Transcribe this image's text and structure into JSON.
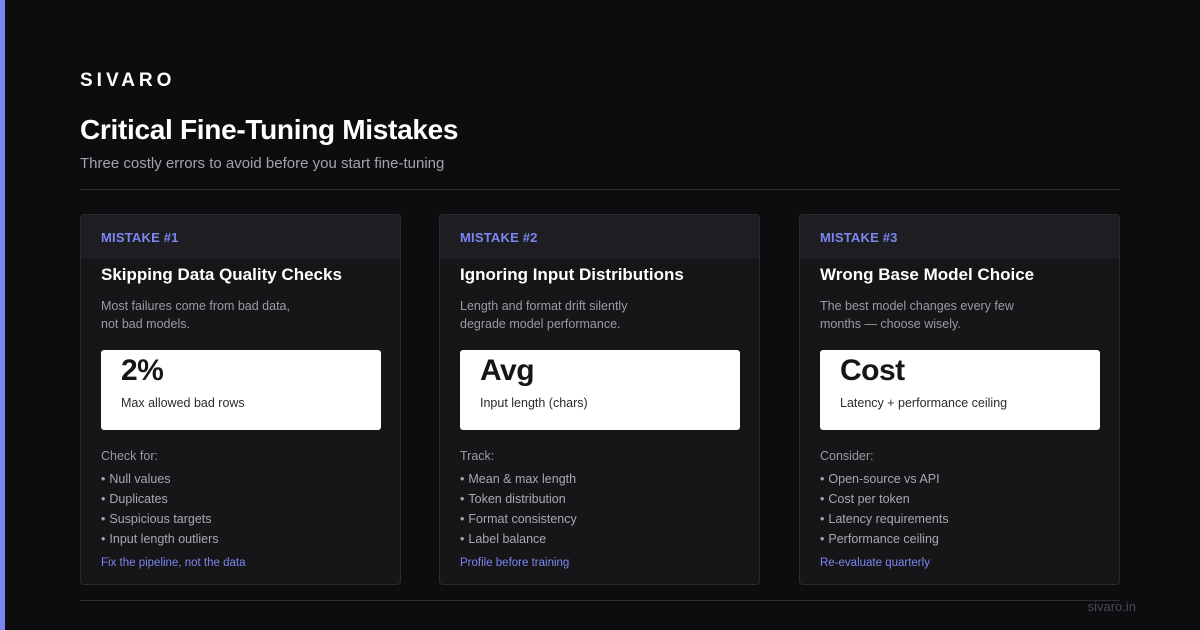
{
  "brand": "SIVARO",
  "title": "Critical Fine-Tuning Mistakes",
  "subtitle": "Three costly errors to avoid before you start fine-tuning",
  "colors": {
    "accent": "#7c86f0",
    "background": "#0d0d0f",
    "card": "#161619",
    "card_header": "#1e1e22"
  },
  "cards": [
    {
      "label": "MISTAKE #1",
      "title": "Skipping Data Quality Checks",
      "desc_line1": "Most failures come from bad data,",
      "desc_line2": "not bad models.",
      "stat_value": "2%",
      "stat_caption": "Max allowed bad rows",
      "list_label": "Check for:",
      "items": [
        "Null values",
        "Duplicates",
        "Suspicious targets",
        "Input length outliers"
      ],
      "footer": "Fix the pipeline, not the data"
    },
    {
      "label": "MISTAKE #2",
      "title": "Ignoring Input Distributions",
      "desc_line1": "Length and format drift silently",
      "desc_line2": "degrade model performance.",
      "stat_value": "Avg",
      "stat_caption": "Input length (chars)",
      "list_label": "Track:",
      "items": [
        "Mean & max length",
        "Token distribution",
        "Format consistency",
        "Label balance"
      ],
      "footer": "Profile before training"
    },
    {
      "label": "MISTAKE #3",
      "title": "Wrong Base Model Choice",
      "desc_line1": "The best model changes every few",
      "desc_line2": "months — choose wisely.",
      "stat_value": "Cost",
      "stat_caption": "Latency + performance ceiling",
      "list_label": "Consider:",
      "items": [
        "Open-source vs API",
        "Cost per token",
        "Latency requirements",
        "Performance ceiling"
      ],
      "footer": "Re-evaluate quarterly"
    }
  ],
  "bullet": "•",
  "domain": "sivaro.in"
}
